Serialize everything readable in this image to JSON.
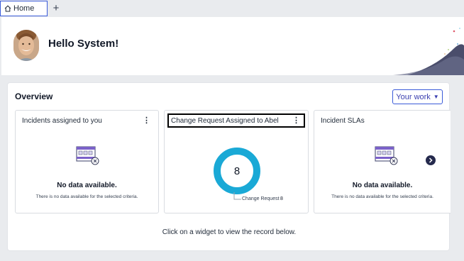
{
  "tabs": {
    "home_label": "Home",
    "add_label": "+"
  },
  "header": {
    "greeting": "Hello System!"
  },
  "overview": {
    "title": "Overview",
    "your_work_label": "Your work",
    "hint": "Click on a widget to view the record below.",
    "cards": [
      {
        "title": "Incidents assigned to you",
        "no_data_title": "No data available.",
        "no_data_text": "There is no data available for the selected criteria."
      },
      {
        "title": "Change Request Assigned to Abel",
        "value": "8",
        "legend_label": "Change Request",
        "legend_value": "8"
      },
      {
        "title": "Incident SLAs",
        "no_data_title": "No data available.",
        "no_data_text": "There is no data available for the selected criteria."
      }
    ]
  },
  "colors": {
    "accent": "#3a5bd9",
    "donut": "#1aa9d6",
    "dark_navy": "#252a4d",
    "empty_icon_purple": "#7b61c9"
  },
  "icons": [
    "home-icon",
    "plus-icon",
    "kebab-icon",
    "no-data-icon",
    "chevron-right-icon",
    "caret-down-icon"
  ]
}
